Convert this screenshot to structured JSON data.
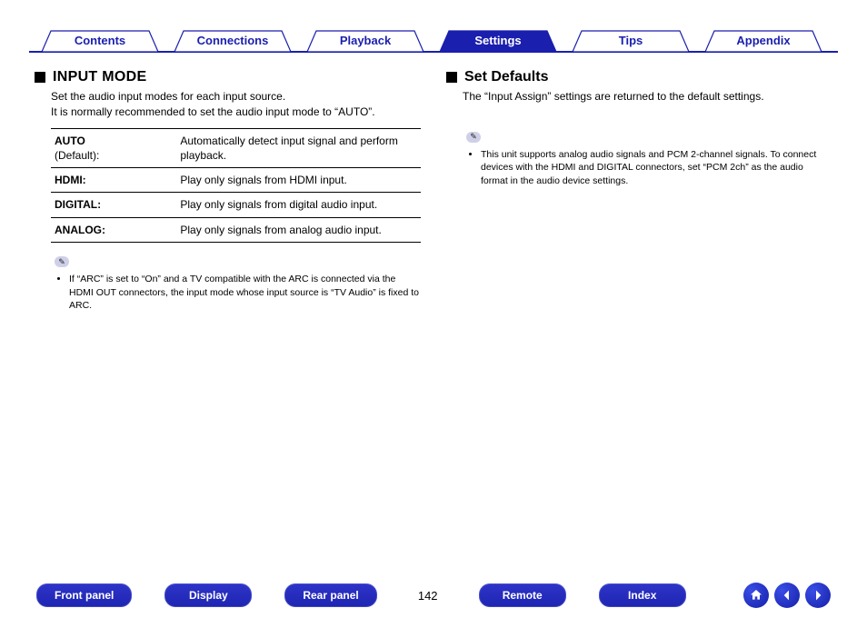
{
  "tabs": [
    {
      "label": "Contents"
    },
    {
      "label": "Connections"
    },
    {
      "label": "Playback"
    },
    {
      "label": "Settings"
    },
    {
      "label": "Tips"
    },
    {
      "label": "Appendix"
    }
  ],
  "left": {
    "title": "Input Mode",
    "desc": "Set the audio input modes for each input source.\nIt is normally recommended to set the audio input mode to “AUTO”.",
    "rows": [
      {
        "key": "AUTO",
        "keySuffix": "(Default):",
        "val": "Automatically detect input signal and perform playback."
      },
      {
        "key": "HDMI:",
        "keySuffix": "",
        "val": "Play only signals from HDMI input."
      },
      {
        "key": "DIGITAL:",
        "keySuffix": "",
        "val": "Play only signals from digital audio input."
      },
      {
        "key": "ANALOG:",
        "keySuffix": "",
        "val": "Play only signals from analog audio input."
      }
    ],
    "note": "If “ARC” is set to “On” and a TV compatible with the ARC is connected via the HDMI OUT connectors, the input mode whose input source is “TV Audio” is fixed to ARC."
  },
  "right": {
    "title": "Set Defaults",
    "desc": "The “Input Assign” settings are returned to the default settings.",
    "note": "This unit supports analog audio signals and PCM 2-channel signals. To connect devices with the HDMI and DIGITAL connectors, set “PCM 2ch” as the audio format in the audio device settings."
  },
  "bottom": {
    "pills": [
      "Front panel",
      "Display",
      "Rear panel"
    ],
    "page": "142",
    "pills2": [
      "Remote",
      "Index"
    ]
  }
}
